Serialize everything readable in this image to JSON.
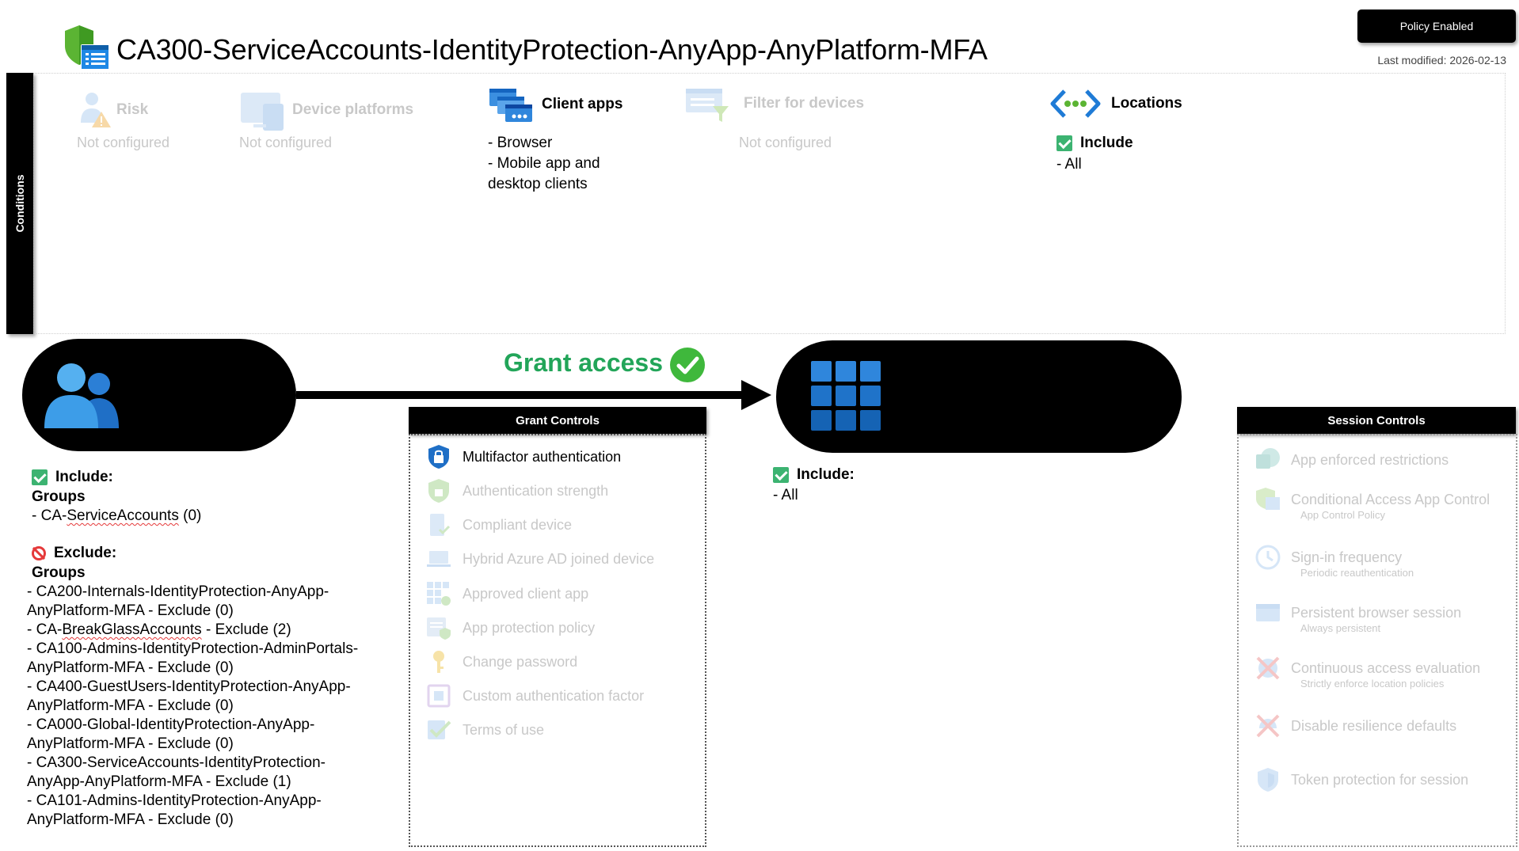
{
  "header": {
    "title": "CA300-ServiceAccounts-IdentityProtection-AnyApp-AnyPlatform-MFA",
    "status_badge": "Policy Enabled",
    "last_modified": "Last modified: 2026-02-13"
  },
  "conditions": {
    "tab_label": "Conditions",
    "risk": {
      "title": "Risk",
      "value": "Not configured"
    },
    "device_platforms": {
      "title": "Device platforms",
      "value": "Not configured"
    },
    "client_apps": {
      "title": "Client apps",
      "items": " - Browser\n - Mobile app and\ndesktop clients"
    },
    "filter_devices": {
      "title": "Filter for devices",
      "value": "Not configured"
    },
    "locations": {
      "title": "Locations",
      "include_label": "Include",
      "items": "- All"
    }
  },
  "users": {
    "label": "Users",
    "include_label": "Include:",
    "include_type": "Groups",
    "include_items": [
      {
        "prefix": " - CA-",
        "underlined": "ServiceAccounts",
        "suffix": " (0)"
      }
    ],
    "exclude_label": "Exclude:",
    "exclude_type": "Groups",
    "exclude_lines": [
      " - CA200-Internals-IdentityProtection-AnyApp-",
      "AnyPlatform-MFA - Exclude (0)",
      "__BG__",
      " - CA100-Admins-IdentityProtection-AdminPortals-",
      "AnyPlatform-MFA - Exclude (0)",
      " - CA400-GuestUsers-IdentityProtection-AnyApp-",
      "AnyPlatform-MFA - Exclude (0)",
      " - CA000-Global-IdentityProtection-AnyApp-",
      "AnyPlatform-MFA - Exclude (0)",
      " - CA300-ServiceAccounts-IdentityProtection-",
      "AnyApp-AnyPlatform-MFA - Exclude (1)",
      " - CA101-Admins-IdentityProtection-AnyApp-",
      "AnyPlatform-MFA - Exclude (0)"
    ],
    "breakglass": {
      "prefix": " - CA-",
      "underlined": "BreakGlassAccounts",
      "suffix": " - Exclude (2)"
    }
  },
  "grant_access": {
    "label": "Grant access"
  },
  "cloud_apps": {
    "label": "All cloud apps",
    "include_label": "Include:",
    "items": "- All"
  },
  "grant_controls": {
    "header": "Grant Controls",
    "items": [
      {
        "label": "Multifactor authentication",
        "icon": "mfa-lock-icon",
        "active": true
      },
      {
        "label": "Authentication strength",
        "icon": "shield-lock-icon",
        "active": false
      },
      {
        "label": "Compliant device",
        "icon": "compliant-device-icon",
        "active": false
      },
      {
        "label": "Hybrid Azure AD joined device",
        "icon": "laptop-icon",
        "active": false
      },
      {
        "label": "Approved client app",
        "icon": "app-grid-icon",
        "active": false
      },
      {
        "label": "App protection policy",
        "icon": "app-protection-icon",
        "active": false
      },
      {
        "label": "Change password",
        "icon": "key-icon",
        "active": false
      },
      {
        "label": "Custom authentication factor",
        "icon": "custom-factor-icon",
        "active": false
      },
      {
        "label": "Terms of use",
        "icon": "terms-check-icon",
        "active": false
      }
    ]
  },
  "session_controls": {
    "header": "Session Controls",
    "items": [
      {
        "label": "App enforced restrictions",
        "sub": "",
        "icon": "sharepoint-icon"
      },
      {
        "label": "Conditional Access App Control",
        "sub": "App Control Policy",
        "icon": "app-control-icon"
      },
      {
        "label": "Sign-in frequency",
        "sub": "Periodic reauthentication",
        "icon": "clock-icon"
      },
      {
        "label": "Persistent browser session",
        "sub": "Always persistent",
        "icon": "browser-icon"
      },
      {
        "label": "Continuous access evaluation",
        "sub": "Strictly enforce location policies",
        "icon": "cae-icon"
      },
      {
        "label": "Disable resilience defaults",
        "sub": "",
        "icon": "resilience-icon"
      },
      {
        "label": "Token protection for session",
        "sub": "",
        "icon": "token-shield-icon"
      }
    ]
  },
  "colors": {
    "grant_green": "#22a559",
    "accent_blue": "#1f7bd6",
    "check_green": "#3cb371",
    "exclude_red": "#e5393a",
    "faded": "#c8c8c8"
  }
}
